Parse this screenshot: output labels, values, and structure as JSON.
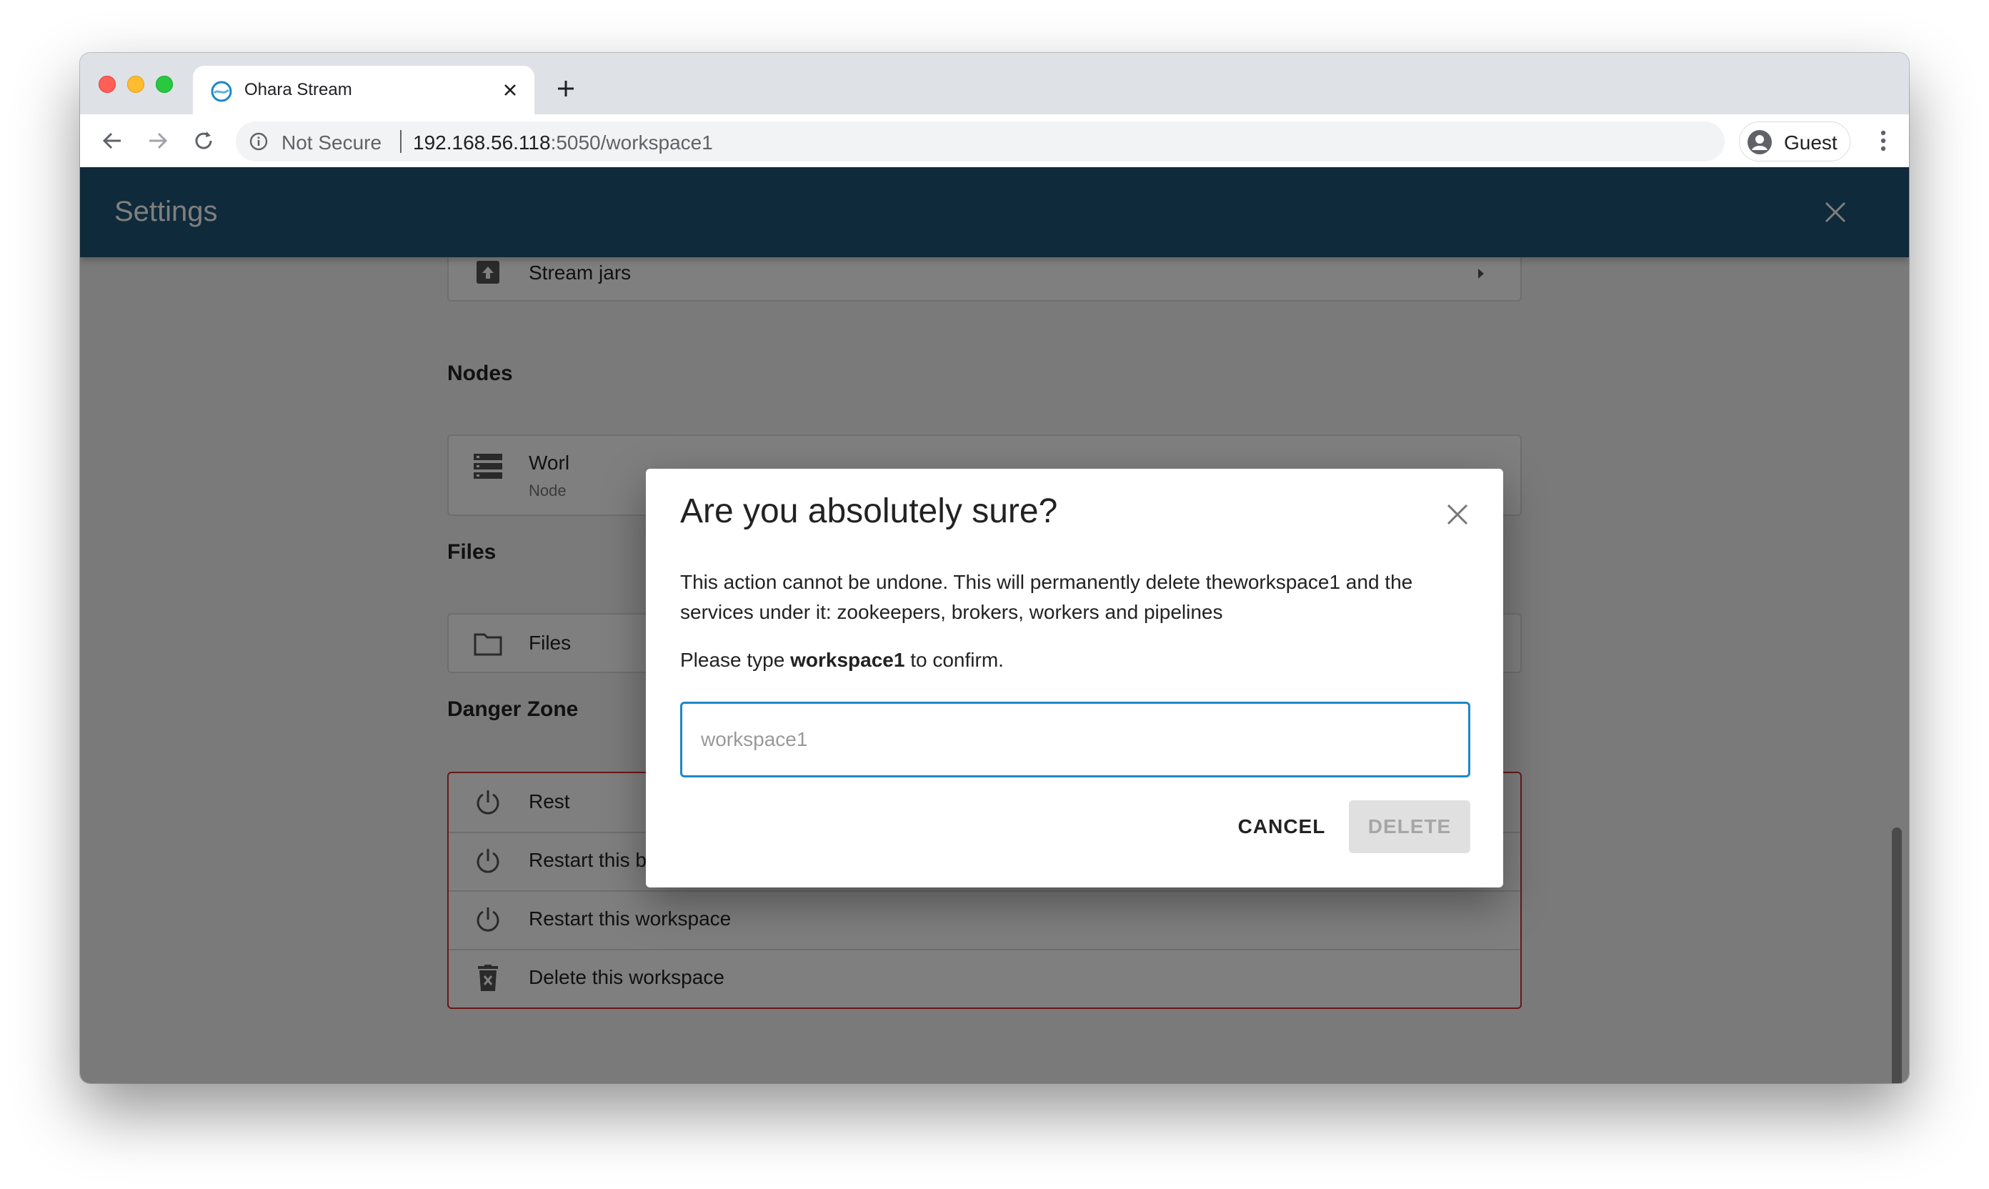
{
  "browser": {
    "tab_title": "Ohara Stream",
    "not_secure_label": "Not Secure",
    "url_host": "192.168.56.118",
    "url_rest": ":5050/workspace1",
    "profile_name": "Guest"
  },
  "settings": {
    "title": "Settings",
    "stream_jars_label": "Stream jars",
    "nodes_section": "Nodes",
    "nodes_row_label": "Worl",
    "nodes_row_sub": "Node",
    "files_section": "Files",
    "files_row_label": "Files",
    "danger_section": "Danger Zone",
    "danger_items": [
      {
        "label": "Rest"
      },
      {
        "label": "Restart this broker"
      },
      {
        "label": "Restart this workspace"
      },
      {
        "label": "Delete this workspace"
      }
    ]
  },
  "dialog": {
    "title": "Are you absolutely sure?",
    "body": "This action cannot be undone. This will permanently delete theworkspace1 and the services under it: zookeepers, brokers, workers and pipelines",
    "confirm_prefix": "Please type ",
    "confirm_name": "workspace1",
    "confirm_suffix": " to confirm.",
    "input_placeholder": "workspace1",
    "input_value": "",
    "cancel_label": "CANCEL",
    "delete_label": "DELETE"
  },
  "colors": {
    "header_bg": "#1e5574",
    "danger_border": "#d32f2f",
    "input_focus": "#1e88c8"
  },
  "icons": [
    "info-icon",
    "back-arrow-icon",
    "forward-arrow-icon",
    "reload-icon",
    "close-icon",
    "plus-icon",
    "guest-avatar-icon",
    "kebab-menu-icon",
    "upload-icon",
    "server-icon",
    "folder-icon",
    "power-icon",
    "trash-icon",
    "caret-right-icon"
  ]
}
